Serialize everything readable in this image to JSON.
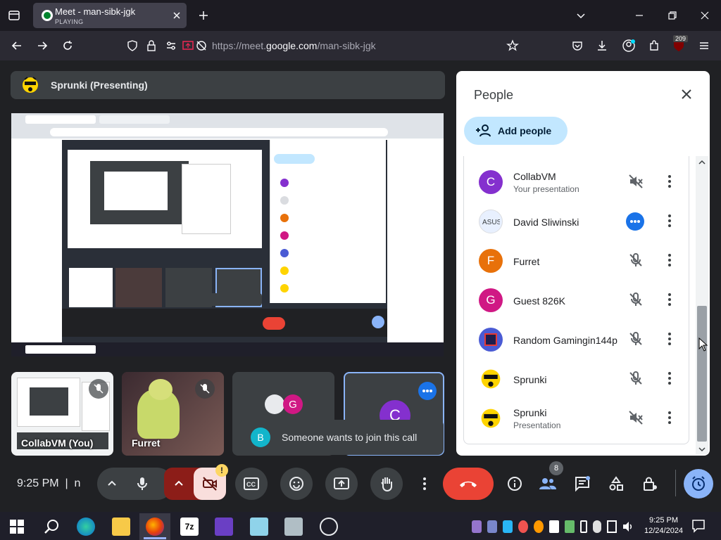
{
  "browser": {
    "tab": {
      "title": "Meet - man-sibk-jgk",
      "subtitle": "PLAYING"
    },
    "url_prefix": "https://meet.",
    "url_domain": "google.com",
    "url_path": "/man-sibk-jgk",
    "notif_count": "209"
  },
  "meet": {
    "presenter": "Sprunki (Presenting)",
    "tiles": [
      {
        "label": "CollabVM (You)"
      },
      {
        "label": "Furret"
      },
      {
        "label": "",
        "initial": "G"
      },
      {
        "label": "",
        "initial": "C"
      }
    ],
    "toast": {
      "initial": "B",
      "text": "Someone wants to join this call"
    },
    "time": "9:25 PM",
    "time_sep": "|",
    "meeting_code": "n",
    "people_badge": "8"
  },
  "people": {
    "title": "People",
    "add_label": "Add people",
    "list": [
      {
        "name": "CollabVM",
        "sub": "Your presentation",
        "initial": "C",
        "color": "#8430ce",
        "mic": "muted-sound"
      },
      {
        "name": "David Sliwinski",
        "sub": "",
        "initial": "",
        "color": "#e8f0fe",
        "mic": "more-active"
      },
      {
        "name": "Furret",
        "sub": "",
        "initial": "F",
        "color": "#e8710a",
        "mic": "muted"
      },
      {
        "name": "Guest 826K",
        "sub": "",
        "initial": "G",
        "color": "#d01884",
        "mic": "muted"
      },
      {
        "name": "Random Gamingin144p",
        "sub": "",
        "initial": "",
        "color": "#4a5bd4",
        "mic": "muted"
      },
      {
        "name": "Sprunki",
        "sub": "",
        "initial": "",
        "color": "#ffd400",
        "mic": "muted"
      },
      {
        "name": "Sprunki",
        "sub": "Presentation",
        "initial": "",
        "color": "#ffd400",
        "mic": "muted-sound"
      }
    ]
  },
  "taskbar": {
    "time": "9:25 PM",
    "date": "12/24/2024"
  },
  "colors": {
    "accent": "#8ab4f8",
    "end_call": "#ea4335",
    "add_btn": "#c2e7ff"
  }
}
